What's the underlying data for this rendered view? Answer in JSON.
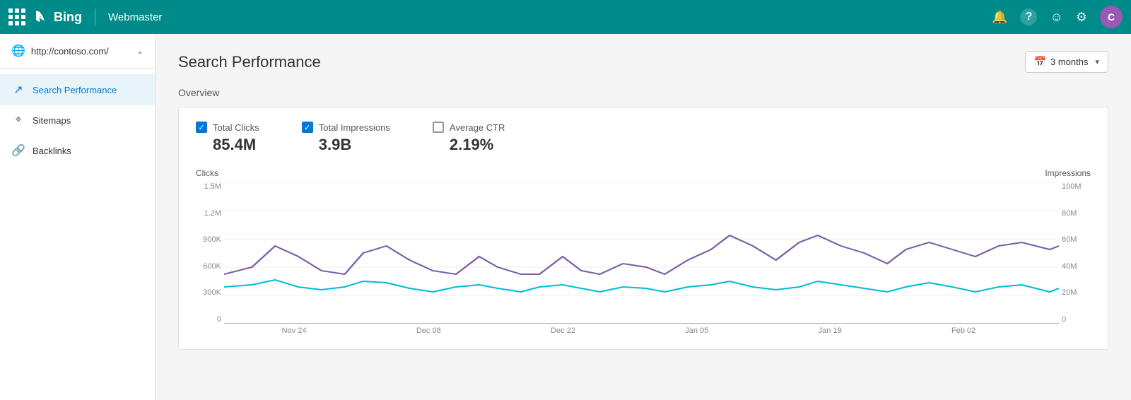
{
  "topnav": {
    "logo_text": "Bing",
    "title": "Webmaster",
    "icons": {
      "bell": "🔔",
      "help": "?",
      "feedback": "😊",
      "settings": "⚙"
    },
    "avatar_letter": "C"
  },
  "sidebar": {
    "url": "http://contoso.com/",
    "nav_items": [
      {
        "id": "search-performance",
        "label": "Search Performance",
        "active": true
      },
      {
        "id": "sitemaps",
        "label": "Sitemaps",
        "active": false
      },
      {
        "id": "backlinks",
        "label": "Backlinks",
        "active": false
      }
    ]
  },
  "header": {
    "title": "Search Performance",
    "date_filter": "3 months"
  },
  "overview": {
    "label": "Overview",
    "metrics": [
      {
        "id": "total-clicks",
        "label": "Total Clicks",
        "value": "85.4M",
        "checked": true
      },
      {
        "id": "total-impressions",
        "label": "Total Impressions",
        "value": "3.9B",
        "checked": true
      },
      {
        "id": "average-ctr",
        "label": "Average CTR",
        "value": "2.19%",
        "checked": false
      }
    ],
    "chart": {
      "y_axis_left_label": "Clicks",
      "y_axis_right_label": "Impressions",
      "y_left_labels": [
        "1.5M",
        "1.2M",
        "900K",
        "600K",
        "300K",
        "0"
      ],
      "y_right_labels": [
        "100M",
        "80M",
        "60M",
        "40M",
        "20M",
        "0"
      ],
      "x_labels": [
        "Nov 24",
        "Dec 08",
        "Dec 22",
        "Jan 05",
        "Jan 19",
        "Feb 02"
      ]
    }
  }
}
